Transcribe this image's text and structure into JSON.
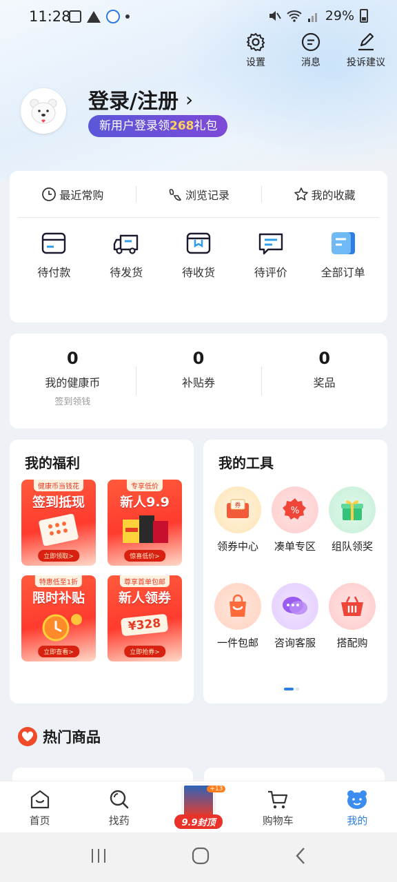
{
  "status_bar": {
    "time": "11:28",
    "battery": "29%"
  },
  "header": {
    "actions": [
      {
        "label": "设置",
        "icon": "gear-icon"
      },
      {
        "label": "消息",
        "icon": "message-icon"
      },
      {
        "label": "投诉建议",
        "icon": "edit-icon"
      }
    ]
  },
  "profile": {
    "login_text": "登录/注册",
    "promo_prefix": "新用户登录领",
    "promo_amount": "268",
    "promo_suffix": "礼包"
  },
  "quick_links": [
    {
      "label": "最近常购",
      "icon": "clock-icon"
    },
    {
      "label": "浏览记录",
      "icon": "footprint-icon"
    },
    {
      "label": "我的收藏",
      "icon": "star-icon"
    }
  ],
  "orders": [
    {
      "label": "待付款",
      "icon": "card-icon"
    },
    {
      "label": "待发货",
      "icon": "truck-icon"
    },
    {
      "label": "待收货",
      "icon": "package-icon"
    },
    {
      "label": "待评价",
      "icon": "comment-icon"
    },
    {
      "label": "全部订单",
      "icon": "orders-icon"
    }
  ],
  "assets": [
    {
      "value": "0",
      "label": "我的健康币",
      "sub": "签到领钱"
    },
    {
      "value": "0",
      "label": "补贴券",
      "sub": ""
    },
    {
      "value": "0",
      "label": "奖品",
      "sub": ""
    }
  ],
  "welfare": {
    "title": "我的福利",
    "tiles": [
      {
        "tag": "健康币当钱花",
        "title": "签到抵现",
        "button": "立即领取>"
      },
      {
        "tag": "专享低价",
        "title": "新人9.9",
        "button": "惊喜低价>"
      },
      {
        "tag": "特惠低至1折",
        "title": "限时补贴",
        "button": "立即查看>"
      },
      {
        "tag": "尊享首单包邮",
        "title": "新人领券",
        "amount": "¥328",
        "button": "立即抢券>"
      }
    ]
  },
  "tools": {
    "title": "我的工具",
    "items": [
      {
        "label": "领券中心",
        "icon": "coupon-icon"
      },
      {
        "label": "凑单专区",
        "icon": "discount-icon"
      },
      {
        "label": "组队领奖",
        "icon": "gift-icon"
      },
      {
        "label": "一件包邮",
        "icon": "bag-icon"
      },
      {
        "label": "咨询客服",
        "icon": "chat-icon"
      },
      {
        "label": "搭配购",
        "icon": "basket-icon"
      }
    ]
  },
  "hot_products": {
    "title": "热门商品"
  },
  "tabbar": {
    "tabs": [
      {
        "label": "首页",
        "icon": "home-icon"
      },
      {
        "label": "找药",
        "icon": "search-icon"
      },
      {
        "label": "9.9封顶",
        "icon": "promo-image",
        "badge": "+13"
      },
      {
        "label": "购物车",
        "icon": "cart-icon"
      },
      {
        "label": "我的",
        "icon": "bear-icon"
      }
    ],
    "active": "我的"
  },
  "colors": {
    "accent": "#2f7ee6",
    "promo_bg": "#6a50d8",
    "promo_highlight": "#ffd35a",
    "red": "#ef4a2a"
  }
}
